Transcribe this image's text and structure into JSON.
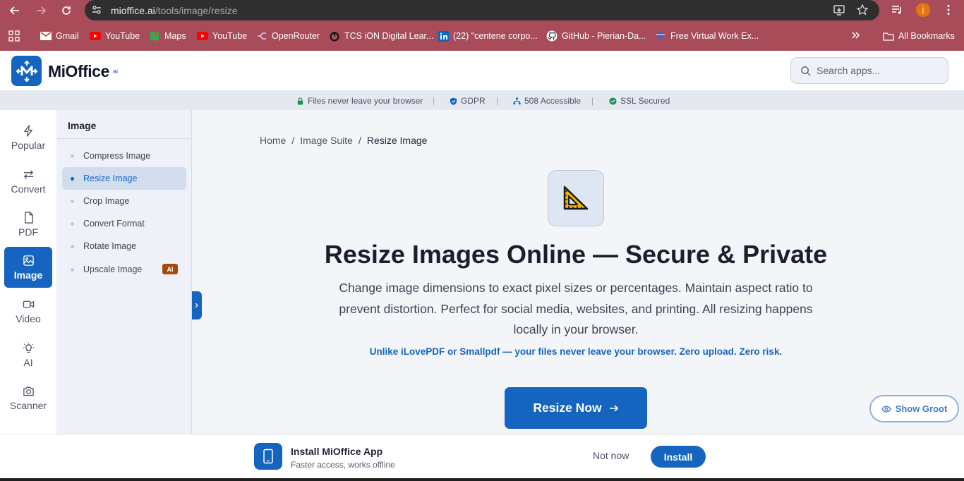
{
  "browser": {
    "url_host": "mioffice.ai",
    "url_path": "/tools/image/resize",
    "profile_initial": "j",
    "bookmarks": [
      {
        "label": "Gmail"
      },
      {
        "label": "YouTube"
      },
      {
        "label": "Maps"
      },
      {
        "label": "YouTube"
      },
      {
        "label": "OpenRouter"
      },
      {
        "label": "TCS iON Digital Lear..."
      },
      {
        "label": "(22) \"centene corpo..."
      },
      {
        "label": "GitHub - Pierian-Da..."
      },
      {
        "label": "Free Virtual Work Ex..."
      }
    ],
    "all_bookmarks": "All Bookmarks"
  },
  "header": {
    "logo_text": "MiOffice",
    "logo_suffix": "ai",
    "search_placeholder": "Search apps..."
  },
  "trust": {
    "items": [
      "Files never leave your browser",
      "GDPR",
      "508 Accessible",
      "SSL Secured"
    ],
    "separator": "|"
  },
  "rail": {
    "items": [
      "Popular",
      "Convert",
      "PDF",
      "Image",
      "Video",
      "AI",
      "Scanner"
    ],
    "active": "Image"
  },
  "subnav": {
    "title": "Image",
    "items": [
      "Compress Image",
      "Resize Image",
      "Crop Image",
      "Convert Format",
      "Rotate Image",
      "Upscale Image"
    ],
    "active": "Resize Image",
    "badge": "AI"
  },
  "breadcrumb": {
    "items": [
      "Home",
      "Image Suite",
      "Resize Image"
    ],
    "separator": "/"
  },
  "hero": {
    "title": "Resize Images Online — Secure & Private",
    "description": "Change image dimensions to exact pixel sizes or percentages. Maintain aspect ratio to prevent distortion. Perfect for social media, websites, and printing. All resizing happens locally in your browser.",
    "note": "Unlike iLovePDF or Smallpdf — your files never leave your browser. Zero upload. Zero risk.",
    "cta_label": "Resize Now",
    "groot_label": "Show Groot"
  },
  "install": {
    "title": "Install MiOffice App",
    "subtitle": "Faster access, works offline",
    "dismiss_label": "Not now",
    "install_label": "Install"
  },
  "colors": {
    "brand": "#1565c0",
    "chrome": "#a84c5a",
    "ai_badge": "#a84a0f"
  }
}
